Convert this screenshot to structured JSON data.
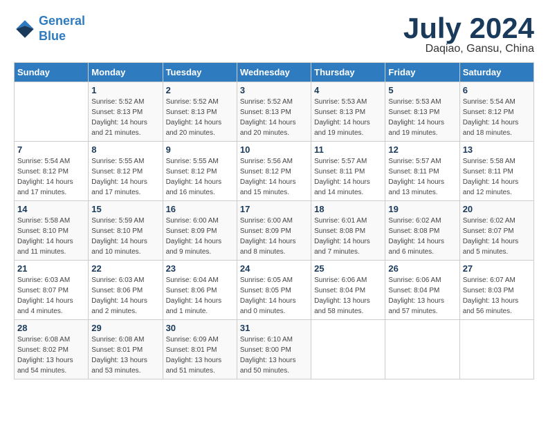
{
  "header": {
    "logo_line1": "General",
    "logo_line2": "Blue",
    "month_title": "July 2024",
    "subtitle": "Daqiao, Gansu, China"
  },
  "weekdays": [
    "Sunday",
    "Monday",
    "Tuesday",
    "Wednesday",
    "Thursday",
    "Friday",
    "Saturday"
  ],
  "weeks": [
    [
      {
        "day": "",
        "info": ""
      },
      {
        "day": "1",
        "info": "Sunrise: 5:52 AM\nSunset: 8:13 PM\nDaylight: 14 hours\nand 21 minutes."
      },
      {
        "day": "2",
        "info": "Sunrise: 5:52 AM\nSunset: 8:13 PM\nDaylight: 14 hours\nand 20 minutes."
      },
      {
        "day": "3",
        "info": "Sunrise: 5:52 AM\nSunset: 8:13 PM\nDaylight: 14 hours\nand 20 minutes."
      },
      {
        "day": "4",
        "info": "Sunrise: 5:53 AM\nSunset: 8:13 PM\nDaylight: 14 hours\nand 19 minutes."
      },
      {
        "day": "5",
        "info": "Sunrise: 5:53 AM\nSunset: 8:13 PM\nDaylight: 14 hours\nand 19 minutes."
      },
      {
        "day": "6",
        "info": "Sunrise: 5:54 AM\nSunset: 8:12 PM\nDaylight: 14 hours\nand 18 minutes."
      }
    ],
    [
      {
        "day": "7",
        "info": "Sunrise: 5:54 AM\nSunset: 8:12 PM\nDaylight: 14 hours\nand 17 minutes."
      },
      {
        "day": "8",
        "info": "Sunrise: 5:55 AM\nSunset: 8:12 PM\nDaylight: 14 hours\nand 17 minutes."
      },
      {
        "day": "9",
        "info": "Sunrise: 5:55 AM\nSunset: 8:12 PM\nDaylight: 14 hours\nand 16 minutes."
      },
      {
        "day": "10",
        "info": "Sunrise: 5:56 AM\nSunset: 8:12 PM\nDaylight: 14 hours\nand 15 minutes."
      },
      {
        "day": "11",
        "info": "Sunrise: 5:57 AM\nSunset: 8:11 PM\nDaylight: 14 hours\nand 14 minutes."
      },
      {
        "day": "12",
        "info": "Sunrise: 5:57 AM\nSunset: 8:11 PM\nDaylight: 14 hours\nand 13 minutes."
      },
      {
        "day": "13",
        "info": "Sunrise: 5:58 AM\nSunset: 8:11 PM\nDaylight: 14 hours\nand 12 minutes."
      }
    ],
    [
      {
        "day": "14",
        "info": "Sunrise: 5:58 AM\nSunset: 8:10 PM\nDaylight: 14 hours\nand 11 minutes."
      },
      {
        "day": "15",
        "info": "Sunrise: 5:59 AM\nSunset: 8:10 PM\nDaylight: 14 hours\nand 10 minutes."
      },
      {
        "day": "16",
        "info": "Sunrise: 6:00 AM\nSunset: 8:09 PM\nDaylight: 14 hours\nand 9 minutes."
      },
      {
        "day": "17",
        "info": "Sunrise: 6:00 AM\nSunset: 8:09 PM\nDaylight: 14 hours\nand 8 minutes."
      },
      {
        "day": "18",
        "info": "Sunrise: 6:01 AM\nSunset: 8:08 PM\nDaylight: 14 hours\nand 7 minutes."
      },
      {
        "day": "19",
        "info": "Sunrise: 6:02 AM\nSunset: 8:08 PM\nDaylight: 14 hours\nand 6 minutes."
      },
      {
        "day": "20",
        "info": "Sunrise: 6:02 AM\nSunset: 8:07 PM\nDaylight: 14 hours\nand 5 minutes."
      }
    ],
    [
      {
        "day": "21",
        "info": "Sunrise: 6:03 AM\nSunset: 8:07 PM\nDaylight: 14 hours\nand 4 minutes."
      },
      {
        "day": "22",
        "info": "Sunrise: 6:03 AM\nSunset: 8:06 PM\nDaylight: 14 hours\nand 2 minutes."
      },
      {
        "day": "23",
        "info": "Sunrise: 6:04 AM\nSunset: 8:06 PM\nDaylight: 14 hours\nand 1 minute."
      },
      {
        "day": "24",
        "info": "Sunrise: 6:05 AM\nSunset: 8:05 PM\nDaylight: 14 hours\nand 0 minutes."
      },
      {
        "day": "25",
        "info": "Sunrise: 6:06 AM\nSunset: 8:04 PM\nDaylight: 13 hours\nand 58 minutes."
      },
      {
        "day": "26",
        "info": "Sunrise: 6:06 AM\nSunset: 8:04 PM\nDaylight: 13 hours\nand 57 minutes."
      },
      {
        "day": "27",
        "info": "Sunrise: 6:07 AM\nSunset: 8:03 PM\nDaylight: 13 hours\nand 56 minutes."
      }
    ],
    [
      {
        "day": "28",
        "info": "Sunrise: 6:08 AM\nSunset: 8:02 PM\nDaylight: 13 hours\nand 54 minutes."
      },
      {
        "day": "29",
        "info": "Sunrise: 6:08 AM\nSunset: 8:01 PM\nDaylight: 13 hours\nand 53 minutes."
      },
      {
        "day": "30",
        "info": "Sunrise: 6:09 AM\nSunset: 8:01 PM\nDaylight: 13 hours\nand 51 minutes."
      },
      {
        "day": "31",
        "info": "Sunrise: 6:10 AM\nSunset: 8:00 PM\nDaylight: 13 hours\nand 50 minutes."
      },
      {
        "day": "",
        "info": ""
      },
      {
        "day": "",
        "info": ""
      },
      {
        "day": "",
        "info": ""
      }
    ]
  ]
}
